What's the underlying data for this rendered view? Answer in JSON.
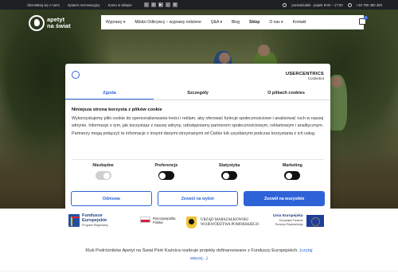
{
  "topbar": {
    "links": [
      "Skontaktuj się z nami",
      "System rezerwacyjny",
      "Konto w sklepie"
    ],
    "social_icons": [
      "facebook-icon",
      "instagram-icon",
      "youtube-icon",
      "tiktok-icon",
      "spotify-icon"
    ],
    "hours": "poniedziałek - piątek 9:00 – 17:00",
    "phone": "+48 790 380 360"
  },
  "brand": {
    "line1": "apetyt",
    "line2": "na świat"
  },
  "nav": {
    "items": [
      "Wyprawy ▾",
      "Młodzi Odkrywcy – wyprawy rodzinne",
      "Q&A ▾",
      "Blog",
      "Sklep",
      "O nas ▾",
      "Kontakt"
    ],
    "active_index": 4,
    "cart_count": "0"
  },
  "cookie": {
    "brand_name": "USERCENTRICS",
    "brand_sub": "Cookiebot",
    "tabs": [
      "Zgoda",
      "Szczegóły",
      "O plikach cookies"
    ],
    "active_tab": 0,
    "title": "Niniejsza strona korzysta z plików cookie",
    "body": "Wykorzystujemy pliki cookie do spersonalizowania treści i reklam, aby oferować funkcje społecznościowe i analizować ruch w naszej witrynie. Informacje o tym, jak korzystasz z naszej witryny, udostępniamy partnerom społecznościowym, reklamowym i analitycznym. Partnerzy mogą połączyć te informacje z innymi danymi otrzymanymi od Ciebie lub uzyskanymi podczas korzystania z ich usług.",
    "toggles": [
      {
        "label": "Niezbędne",
        "state": "on-disabled"
      },
      {
        "label": "Preferencje",
        "state": "off"
      },
      {
        "label": "Statystyka",
        "state": "off"
      },
      {
        "label": "Marketing",
        "state": "off"
      }
    ],
    "buttons": {
      "reject": "Odmowa",
      "allow_selection": "Zezwól na wybór",
      "allow_all": "Zezwól na wszystkie"
    }
  },
  "funds": {
    "fe_title_1": "Fundusze",
    "fe_title_2": "Europejskie",
    "fe_sub": "Program Regionalny",
    "rp_line1": "Rzeczpospolita",
    "rp_line2": "Polska",
    "pom_line1": "URZĄD MARSZAŁKOWSKI",
    "pom_line2": "WOJEWÓDZTWA POMORSKIEGO",
    "ue_title": "Unia Europejska",
    "ue_sub1": "Europejski Fundusz",
    "ue_sub2": "Rozwoju Regionalnego"
  },
  "footnote": {
    "text": "Klub Podróżników Apetyt na Świat Piotr Kaźnica realizuje projekty dofinansowane z Funduszy Europejskich.",
    "link_part1": "(czytaj",
    "link_part2": "więcej...)"
  },
  "colors": {
    "accent": "#2e63d8",
    "topbar": "#1e2024"
  }
}
